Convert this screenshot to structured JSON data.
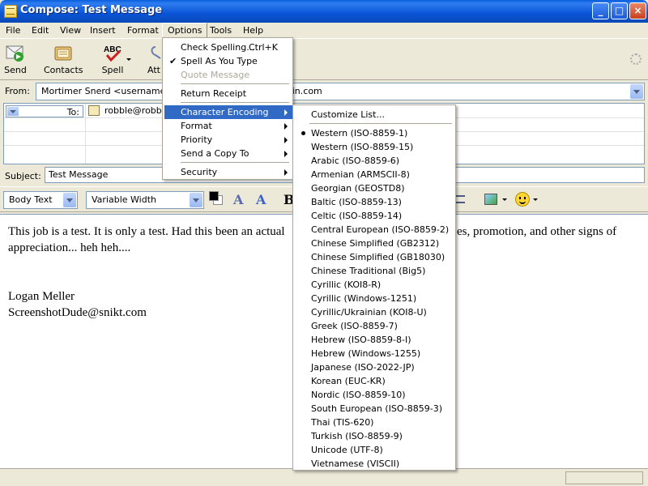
{
  "window": {
    "title": "Compose: Test Message"
  },
  "menubar": [
    "File",
    "Edit",
    "View",
    "Insert",
    "Format",
    "Options",
    "Tools",
    "Help"
  ],
  "toolbar": {
    "send": "Send",
    "contacts": "Contacts",
    "spell": "Spell",
    "attach": "Att"
  },
  "from": {
    "label": "From:",
    "value": "Mortimer Snerd <username@d",
    "value_tail": "ain.com"
  },
  "to": {
    "label": "To:",
    "value": "robble@robble"
  },
  "subject": {
    "label": "Subject:",
    "value": "Test Message"
  },
  "format_bar": {
    "paragraph": "Body Text",
    "font": "Variable Width",
    "bold": "B"
  },
  "body": {
    "para1_a": "This job is a test.  It is only a test.  Had this been an actual",
    "para1_b": "es, promotion, and other signs of",
    "para1_c": "appreciation... heh heh....",
    "sig_name": "Logan Meller",
    "sig_email": "ScreenshotDude@snikt.com"
  },
  "options_menu": {
    "check_spelling": "Check Spelling...",
    "check_spelling_shortcut": "Ctrl+K",
    "spell_as_you_type": "Spell As You Type",
    "quote_message": "Quote Message",
    "return_receipt": "Return Receipt",
    "character_encoding": "Character Encoding",
    "format": "Format",
    "priority": "Priority",
    "send_copy_to": "Send a Copy To",
    "security": "Security"
  },
  "encoding_menu": {
    "customize": "Customize List...",
    "items": [
      "Western (ISO-8859-1)",
      "Western (ISO-8859-15)",
      "Arabic (ISO-8859-6)",
      "Armenian (ARMSCII-8)",
      "Georgian (GEOSTD8)",
      "Baltic (ISO-8859-13)",
      "Celtic (ISO-8859-14)",
      "Central European (ISO-8859-2)",
      "Chinese Simplified (GB2312)",
      "Chinese Simplified (GB18030)",
      "Chinese Traditional (Big5)",
      "Cyrillic (KOI8-R)",
      "Cyrillic (Windows-1251)",
      "Cyrillic/Ukrainian (KOI8-U)",
      "Greek (ISO-8859-7)",
      "Hebrew (ISO-8859-8-I)",
      "Hebrew (Windows-1255)",
      "Japanese (ISO-2022-JP)",
      "Korean (EUC-KR)",
      "Nordic (ISO-8859-10)",
      "South European (ISO-8859-3)",
      "Thai (TIS-620)",
      "Turkish (ISO-8859-9)",
      "Unicode (UTF-8)",
      "Vietnamese (VISCII)"
    ],
    "selected": "Western (ISO-8859-1)"
  }
}
